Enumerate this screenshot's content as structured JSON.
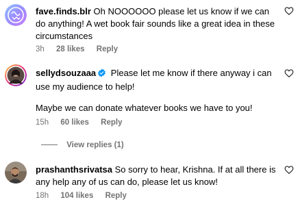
{
  "comments": [
    {
      "username": "fave.finds.blr",
      "text": "Oh NOOOOOO please let us know if we can do anything! A wet book fair sounds like a great idea in these circumstances",
      "time": "3h",
      "likes": "28 likes",
      "reply": "Reply",
      "verified": false
    },
    {
      "username": "sellydsouzaaa",
      "text": "Please let me know if there anyway i can use my audience to help!",
      "text2": "Maybe we can donate whatever books we have to you!",
      "time": "15h",
      "likes": "60 likes",
      "reply": "Reply",
      "verified": true,
      "view_replies": "View replies (1)"
    },
    {
      "username": "prashanthsrivatsa",
      "text": "So sorry to hear, Krishna. If at all there is any help any of us can do, please let us know!",
      "time": "18h",
      "likes": "104 likes",
      "reply": "Reply",
      "verified": false
    }
  ],
  "colors": {
    "text": "#000000",
    "meta": "#737373",
    "verified": "#0095f6"
  },
  "icons": {
    "like": "heart-outline-icon",
    "verified": "verified-badge-icon"
  }
}
